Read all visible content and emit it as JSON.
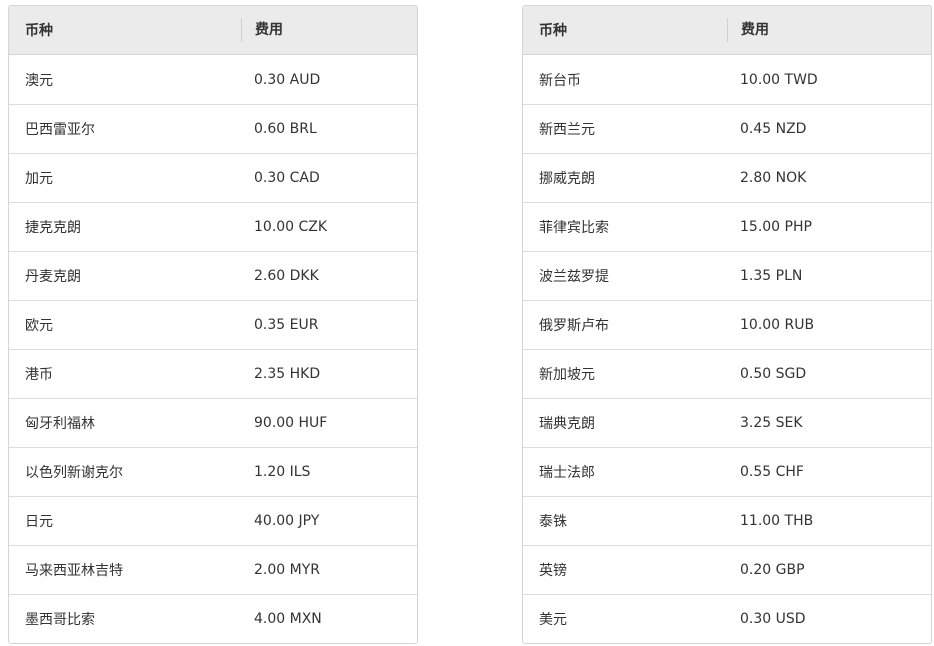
{
  "tables": [
    {
      "header": {
        "currency": "币种",
        "fee": "费用"
      },
      "rows": [
        {
          "currency": "澳元",
          "fee": "0.30 AUD"
        },
        {
          "currency": "巴西雷亚尔",
          "fee": "0.60 BRL"
        },
        {
          "currency": "加元",
          "fee": "0.30 CAD"
        },
        {
          "currency": "捷克克朗",
          "fee": "10.00 CZK"
        },
        {
          "currency": "丹麦克朗",
          "fee": "2.60 DKK"
        },
        {
          "currency": "欧元",
          "fee": "0.35 EUR"
        },
        {
          "currency": "港币",
          "fee": "2.35 HKD"
        },
        {
          "currency": "匈牙利福林",
          "fee": "90.00 HUF"
        },
        {
          "currency": "以色列新谢克尔",
          "fee": "1.20 ILS"
        },
        {
          "currency": "日元",
          "fee": "40.00 JPY"
        },
        {
          "currency": "马来西亚林吉特",
          "fee": "2.00 MYR"
        },
        {
          "currency": "墨西哥比索",
          "fee": "4.00 MXN"
        }
      ]
    },
    {
      "header": {
        "currency": "币种",
        "fee": "费用"
      },
      "rows": [
        {
          "currency": "新台币",
          "fee": "10.00 TWD"
        },
        {
          "currency": "新西兰元",
          "fee": "0.45 NZD"
        },
        {
          "currency": "挪威克朗",
          "fee": "2.80 NOK"
        },
        {
          "currency": "菲律宾比索",
          "fee": "15.00 PHP"
        },
        {
          "currency": "波兰兹罗提",
          "fee": "1.35 PLN"
        },
        {
          "currency": "俄罗斯卢布",
          "fee": "10.00 RUB"
        },
        {
          "currency": "新加坡元",
          "fee": "0.50 SGD"
        },
        {
          "currency": "瑞典克朗",
          "fee": "3.25 SEK"
        },
        {
          "currency": "瑞士法郎",
          "fee": "0.55 CHF"
        },
        {
          "currency": "泰铢",
          "fee": "11.00 THB"
        },
        {
          "currency": "英镑",
          "fee": "0.20 GBP"
        },
        {
          "currency": "美元",
          "fee": "0.30 USD"
        }
      ]
    }
  ]
}
